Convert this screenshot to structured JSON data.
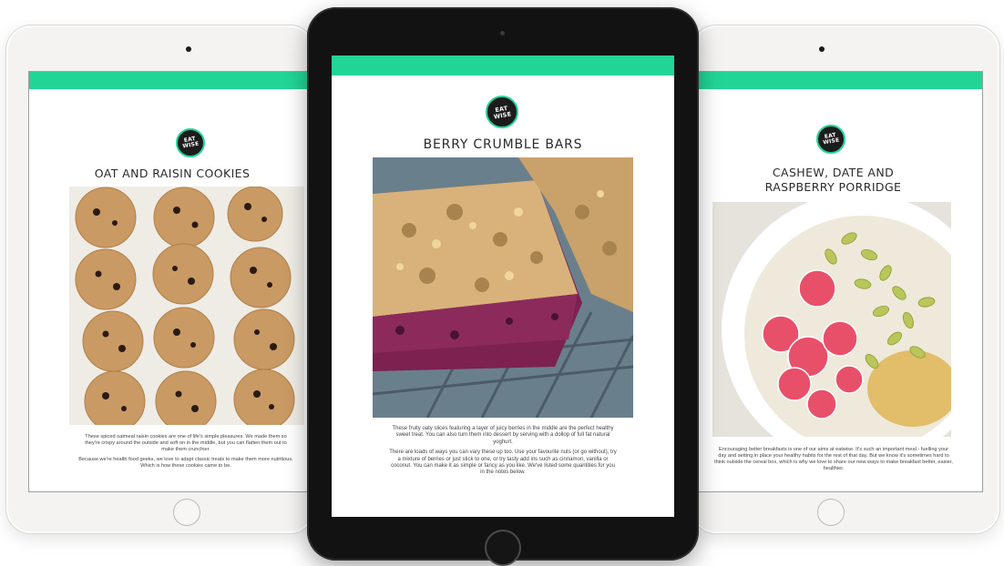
{
  "theme": {
    "accent": "#22d596",
    "logo_bg": "#1c1c1c"
  },
  "brand": {
    "logo_label": "EAT WISE"
  },
  "pages": {
    "left": {
      "title": "OAT AND RAISIN COOKIES",
      "paragraphs": [
        "These spiced oatmeal raisin cookies are one of life's simple pleasures. We made them so they're crispy around the outside and soft on in the middle, but you can flatten them out to make them crunchier.",
        "Because we're health food geeks, we love to adapt classic treats to make them more nutritious. Which is how these cookies came to be."
      ]
    },
    "center": {
      "title": "BERRY CRUMBLE BARS",
      "paragraphs": [
        "These fruity oaty slices featuring a layer of juicy berries in the middle are the perfect healthy sweet treat. You can also turn them into dessert by serving with a dollop of full fat natural yoghurt.",
        "There are loads of ways you can vary these up too. Use your favourite nuts (or go without), try a mixture of berries or just stick to one, or try tasty add ins such as cinnamon, vanilla or coconut. You can make it as simple or fancy as you like. We've listed some quantities for you in the notes below."
      ]
    },
    "right": {
      "title": "CASHEW, DATE AND RASPBERRY PORRIDGE",
      "paragraphs": [
        "Encouraging better breakfasts is one of our aims at eatwise. It's such an important meal - fuelling your day and setting in place your healthy habits for the rest of that day. But we know it's sometimes hard to think outside the cereal box, which is why we love to share our new ways to make breakfast better, easier, healthier."
      ]
    }
  }
}
